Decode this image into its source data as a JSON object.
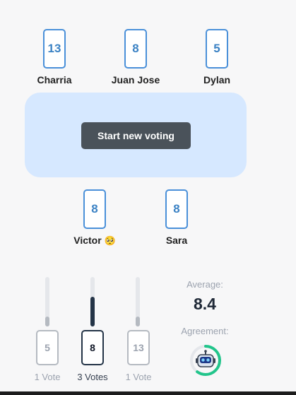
{
  "players": [
    {
      "name": "Charria",
      "card": "13"
    },
    {
      "name": "Juan Jose",
      "card": "8"
    },
    {
      "name": "Dylan",
      "card": "5"
    },
    {
      "name": "Victor",
      "card": "8",
      "emoji": "🥺"
    },
    {
      "name": "Sara",
      "card": "8"
    }
  ],
  "table": {
    "start_label": "Start new voting"
  },
  "results": [
    {
      "card": "5",
      "votes": "1 Vote",
      "share": 0.2,
      "selected": false
    },
    {
      "card": "8",
      "votes": "3 Votes",
      "share": 0.6,
      "selected": true
    },
    {
      "card": "13",
      "votes": "1 Vote",
      "share": 0.2,
      "selected": false
    }
  ],
  "summary": {
    "average_label": "Average:",
    "average_value": "8.4",
    "agreement_label": "Agreement:",
    "agreement": 0.6
  },
  "colors": {
    "accent": "#4a90d9",
    "button": "#4a525a",
    "table": "#d6e8ff",
    "agreement_ring": "#22c58b"
  }
}
